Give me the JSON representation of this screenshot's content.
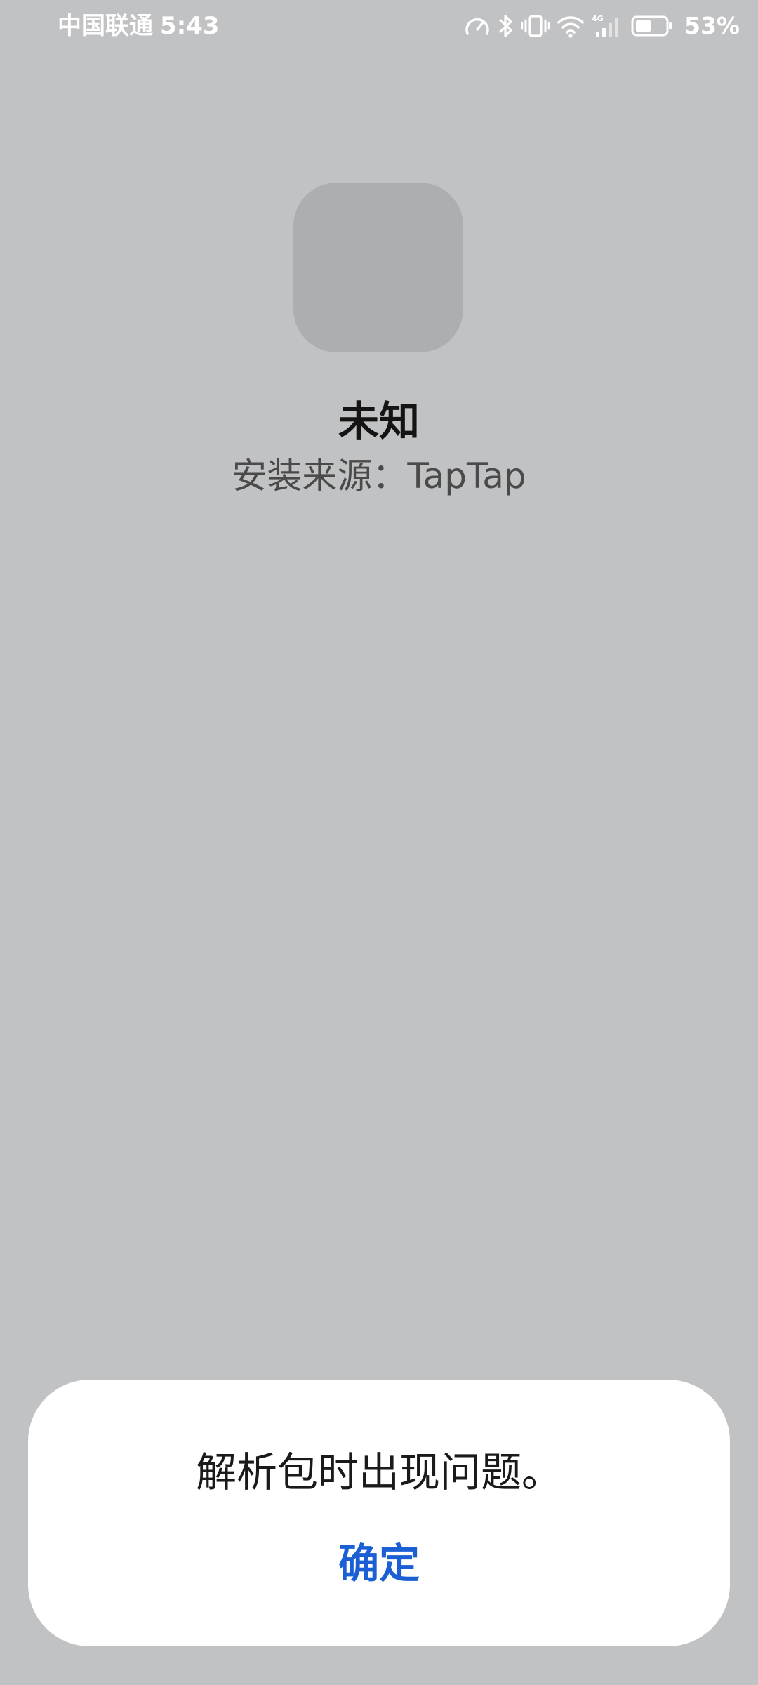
{
  "status_bar": {
    "carrier": "中国联通",
    "time": "5:43",
    "network_badge": "4G",
    "battery_percent": "53%",
    "battery_level": 0.53,
    "icons": [
      "speed-meter-icon",
      "bluetooth-icon",
      "vibrate-icon",
      "wifi-icon",
      "cellular-signal-icon",
      "battery-icon"
    ]
  },
  "app": {
    "name": "未知",
    "source_line": "安装来源：TapTap"
  },
  "dialog": {
    "message": "解析包时出现问题。",
    "confirm_label": "确定"
  },
  "colors": {
    "background": "#c1c2c4",
    "icon_placeholder": "#adaeb0",
    "dialog_background": "#ffffff",
    "accent": "#1a5fd3"
  }
}
